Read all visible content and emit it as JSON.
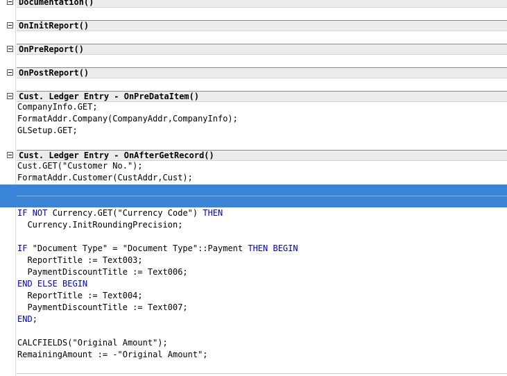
{
  "sections": [
    {
      "title": "Documentation()"
    },
    {
      "title": "OnInitReport()"
    },
    {
      "title": "OnPreReport()"
    },
    {
      "title": "OnPostReport()"
    },
    {
      "title": "Cust. Ledger Entry - OnPreDataItem()"
    },
    {
      "title": "Cust. Ledger Entry - OnAfterGetRecord()"
    }
  ],
  "code": {
    "pre_data_item": [
      "CompanyInfo.GET;",
      "FormatAddr.Company(CompanyAddr,CompanyInfo);",
      "GLSetup.GET;"
    ],
    "after_get_record_top": [
      "Cust.GET(\"Customer No.\");",
      "FormatAddr.Customer(CustAddr,Cust);"
    ],
    "l1_kw1": "IF",
    "l1_kw2": "NOT",
    "l1_text": " Currency.GET(\"Currency Code\") ",
    "l1_kw3": "THEN",
    "l2": "  Currency.InitRoundingPrecision;",
    "l3_kw1": "IF",
    "l3_text": " \"Document Type\" = \"Document Type\"::Payment ",
    "l3_kw2": "THEN BEGIN",
    "l4": "  ReportTitle := Text003;",
    "l5": "  PaymentDiscountTitle := Text006;",
    "l6_kw": "END ELSE BEGIN",
    "l7": "  ReportTitle := Text004;",
    "l8": "  PaymentDiscountTitle := Text007;",
    "l9_kw": "END",
    "l9_text": ";",
    "l10": "CALCFIELDS(\"Original Amount\");",
    "l11": "RemainingAmount := -\"Original Amount\";"
  },
  "colors": {
    "keyword": "#0000cc",
    "selection": "#3a84d8"
  }
}
